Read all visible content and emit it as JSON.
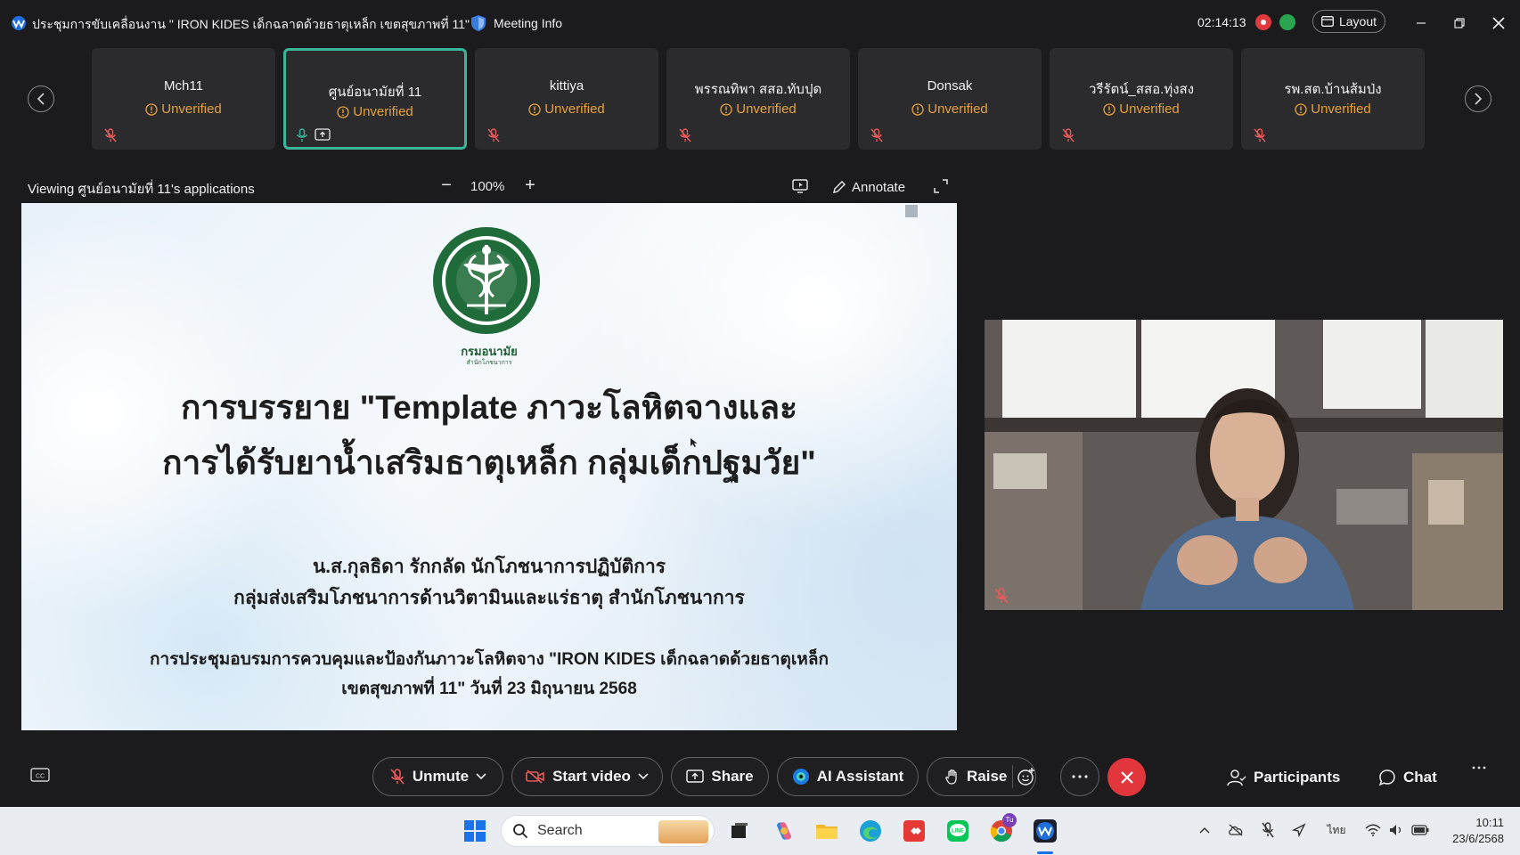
{
  "window": {
    "title": "ประชุมการขับเคลื่อนงาน \" IRON KIDES เด็กฉลาดด้วยธาตุเหล็ก เขตสุขภาพที่ 11\" ...",
    "meeting_info_label": "Meeting Info",
    "timer": "02:14:13",
    "layout_label": "Layout"
  },
  "participants": [
    {
      "name": "Mch11",
      "status": "Unverified",
      "active": false
    },
    {
      "name": "ศูนย์อนามัยที่ 11",
      "status": "Unverified",
      "active": true
    },
    {
      "name": "kittiya",
      "status": "Unverified",
      "active": false
    },
    {
      "name": "พรรณทิพา สสอ.ทับปุด",
      "status": "Unverified",
      "active": false
    },
    {
      "name": "Donsak",
      "status": "Unverified",
      "active": false
    },
    {
      "name": "วรีรัตน์_สสอ.ทุ่งสง",
      "status": "Unverified",
      "active": false
    },
    {
      "name": "รพ.สต.บ้านส้มป่ง",
      "status": "Unverified",
      "active": false
    }
  ],
  "view_toolbar": {
    "viewing_label": "Viewing ศูนย์อนามัยที่ 11's applications",
    "zoom_out": "−",
    "zoom_level": "100%",
    "zoom_in": "+",
    "annotate_label": "Annotate"
  },
  "slide": {
    "dept_name": "กรมอนามัย",
    "dept_sub": "สำนักโภชนาการ",
    "title_line1": "การบรรยาย  \"Template ภาวะโลหิตจางและ",
    "title_line2": "การได้รับยาน้ำเสริมธาตุเหล็ก กลุ่มเด็กปฐมวัย\"",
    "author_line1": "น.ส.กุลธิดา รักกลัด นักโภชนาการปฏิบัติการ",
    "author_line2": "กลุ่มส่งเสริมโภชนาการด้านวิตามินและแร่ธาตุ สำนักโภชนาการ",
    "event_line1": "การประชุมอบรมการควบคุมและป้องกันภาวะโลหิตจาง \"IRON KIDES เด็กฉลาดด้วยธาตุเหล็ก",
    "event_line2": "เขตสุขภาพที่ 11\" วันที่ 23 มิถุนายน 2568"
  },
  "controls": {
    "unmute": "Unmute",
    "start_video": "Start video",
    "share": "Share",
    "ai_assistant": "AI Assistant",
    "raise": "Raise",
    "participants": "Participants",
    "chat": "Chat"
  },
  "taskbar": {
    "search_placeholder": "Search",
    "language": "ไทย",
    "time": "10:11",
    "date": "23/6/2568",
    "chrome_badge": "Tu"
  },
  "colors": {
    "active_tile_border": "#39b59a",
    "unverified": "#e6a23c",
    "end_call": "#e1363c",
    "record": "#e0393e"
  }
}
